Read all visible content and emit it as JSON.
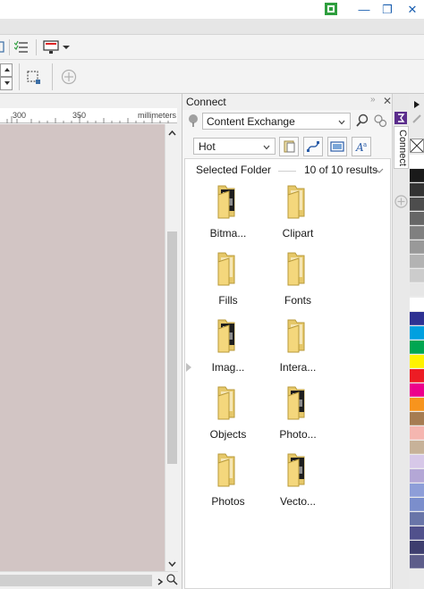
{
  "window": {
    "minimize_glyph": "—",
    "restore_glyph": "❐",
    "close_glyph": "✕"
  },
  "ruler": {
    "labels": [
      "300",
      "350",
      "millimeters"
    ]
  },
  "docker": {
    "title": "Connect",
    "source": "Content Exchange",
    "filter": "Hot",
    "selected_folder_label": "Selected Folder",
    "results": "10 of 10 results",
    "tab_label": "Connect",
    "folders": [
      {
        "label": "Bitma...",
        "icon": "folder-with-image-icon"
      },
      {
        "label": "Clipart",
        "icon": "folder-icon"
      },
      {
        "label": "Fills",
        "icon": "folder-icon"
      },
      {
        "label": "Fonts",
        "icon": "folder-icon"
      },
      {
        "label": "Imag...",
        "icon": "folder-with-image-icon"
      },
      {
        "label": "Intera...",
        "icon": "folder-icon"
      },
      {
        "label": "Objects",
        "icon": "folder-icon"
      },
      {
        "label": "Photo...",
        "icon": "folder-with-image-icon"
      },
      {
        "label": "Photos",
        "icon": "folder-icon"
      },
      {
        "label": "Vecto...",
        "icon": "folder-with-image-icon"
      }
    ]
  },
  "palette": {
    "colors": [
      "#ffffff",
      "#1a1a1a",
      "#333333",
      "#4d4d4d",
      "#666666",
      "#808080",
      "#999999",
      "#b3b3b3",
      "#cccccc",
      "#e6e6e6",
      "#ffffff",
      "#2e3192",
      "#00a0e0",
      "#00a651",
      "#fff200",
      "#ed1c24",
      "#ec008c",
      "#f7941d",
      "#a67c52",
      "#f5b6b0",
      "#c7b299",
      "#d7c8e8",
      "#b4a7d6",
      "#8e9ed8",
      "#7b8ecc",
      "#6975a8",
      "#51518c",
      "#3e3e6e",
      "#5d5d8a"
    ]
  }
}
